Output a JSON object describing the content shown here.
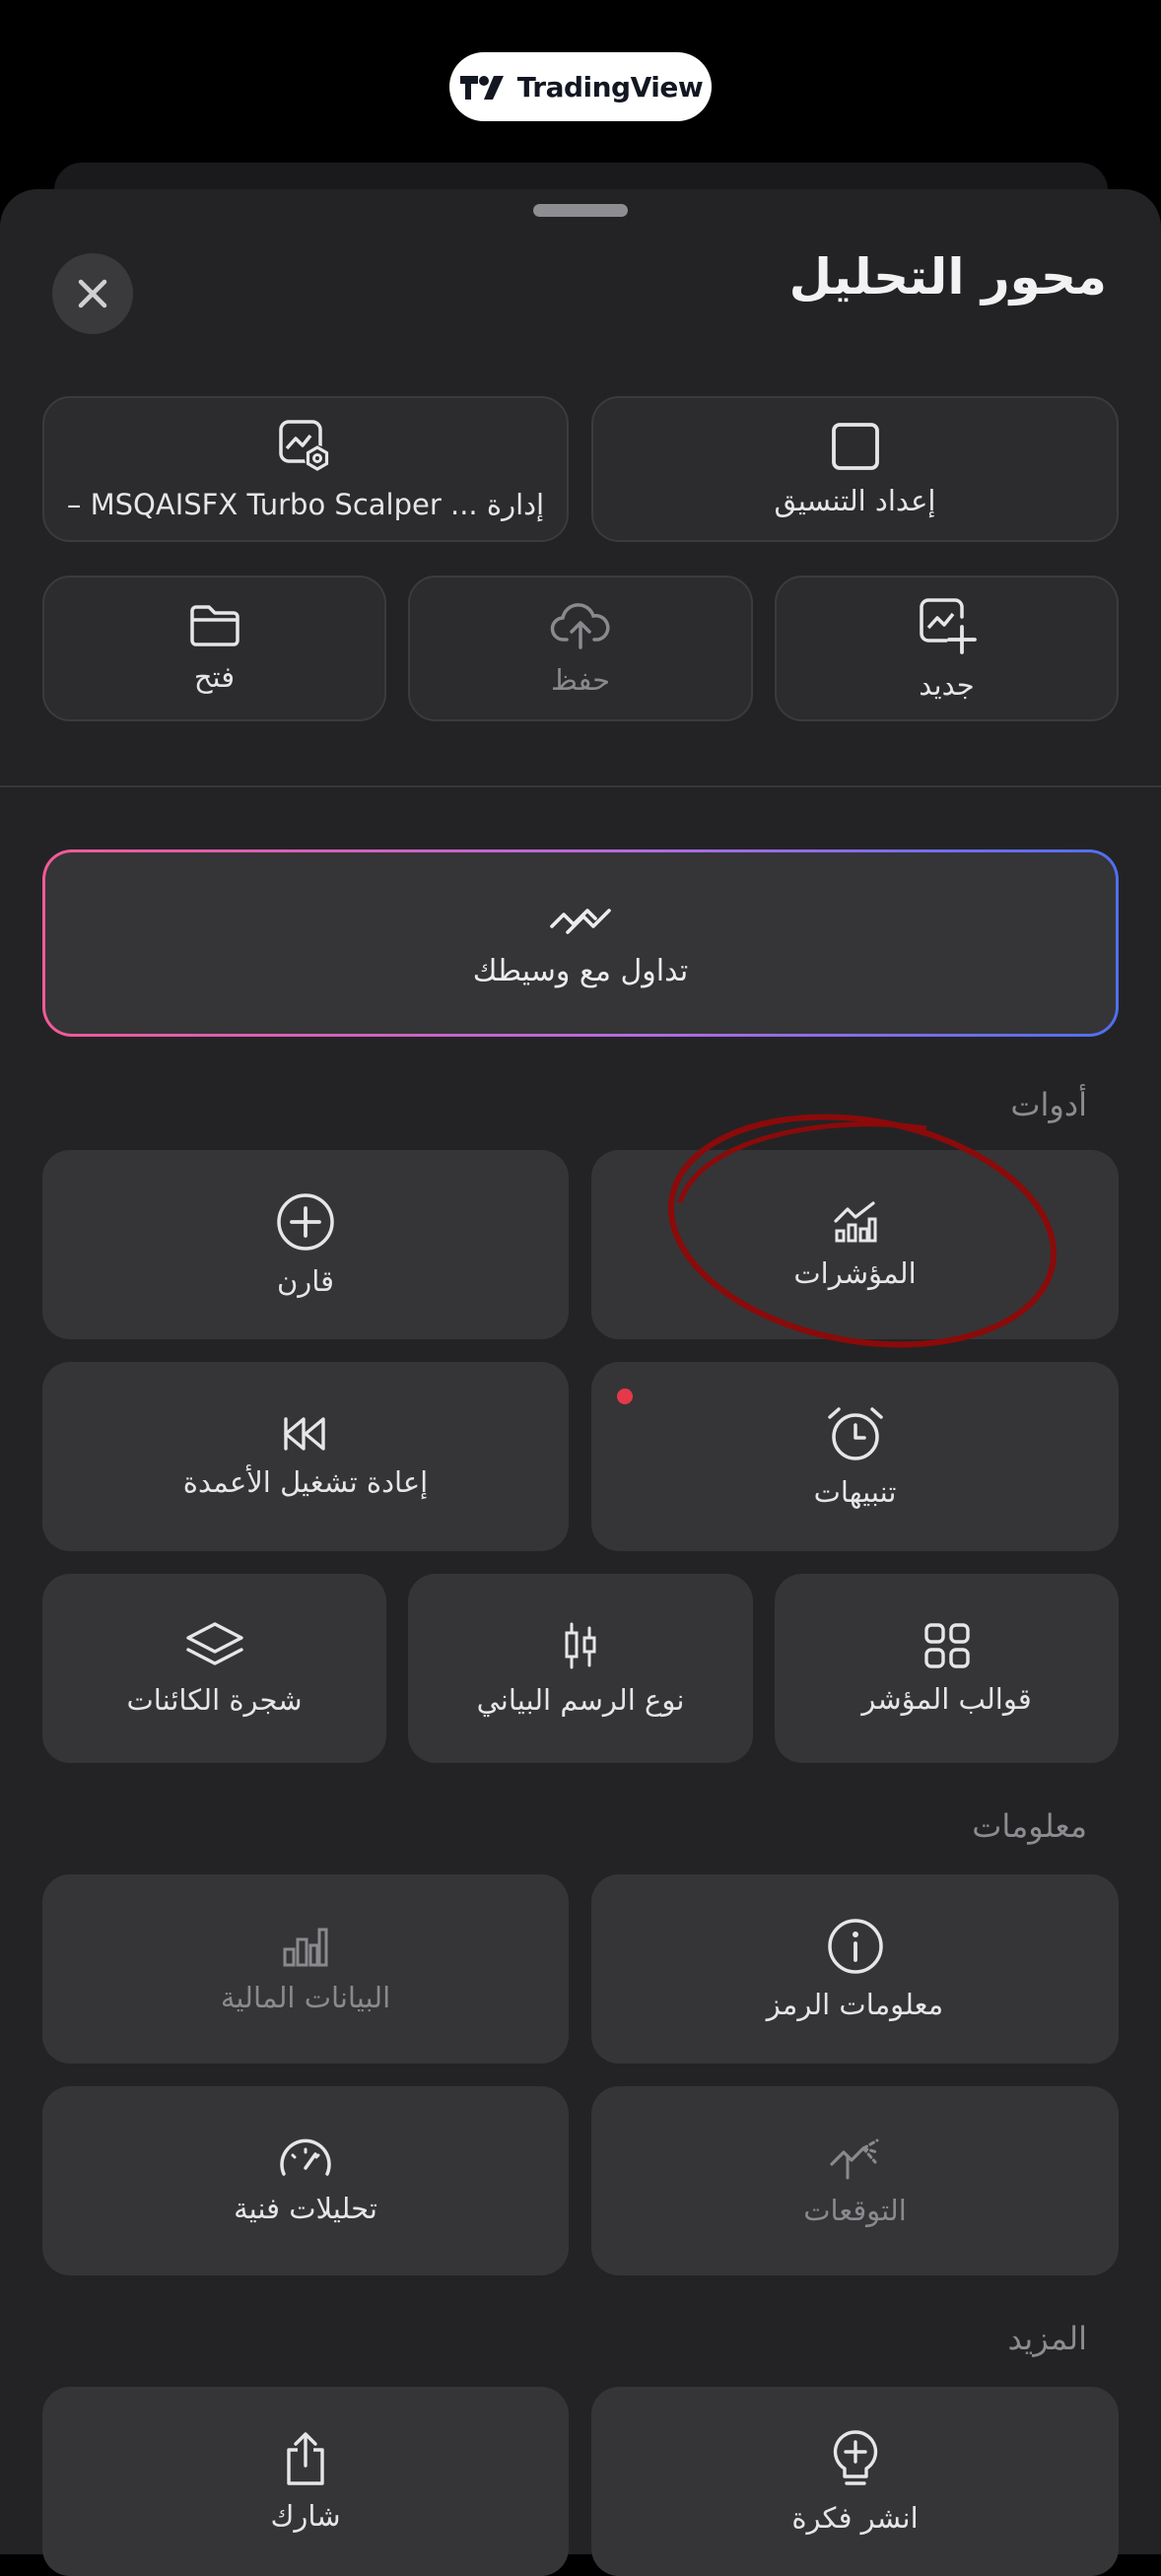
{
  "brand": {
    "name": "TradingView"
  },
  "sheet": {
    "title": "محور التحليل"
  },
  "layout_actions": {
    "manage_label": "إدارة ... MSQAISFX Turbo Scalper –",
    "layout_setup_label": "إعداد التنسيق",
    "new_label": "جديد",
    "save_label": "حفظ",
    "open_label": "فتح"
  },
  "broker": {
    "label": "تداول مع وسيطك"
  },
  "tools": {
    "heading": "أدوات",
    "indicators_label": "المؤشرات",
    "compare_label": "قارن",
    "alerts_label": "تنبيهات",
    "bar_replay_label": "إعادة تشغيل الأعمدة",
    "indicator_templates_label": "قوالب المؤشر",
    "chart_type_label": "نوع الرسم البياني",
    "object_tree_label": "شجرة الكائنات"
  },
  "info": {
    "heading": "معلومات",
    "symbol_info_label": "معلومات الرمز",
    "financials_label": "البيانات المالية",
    "forecasts_label": "التوقعات",
    "technicals_label": "تحليلات فنية"
  },
  "more": {
    "heading": "المزيد",
    "publish_idea_label": "انشر فكرة",
    "share_label": "شارك"
  },
  "colors": {
    "sheet_bg": "#232325",
    "tile_bg": "#353537",
    "accent_pink": "#f25a98",
    "accent_blue": "#4f6ff0",
    "alert_dot": "#e5394a",
    "annotation": "#8b0a0a"
  }
}
